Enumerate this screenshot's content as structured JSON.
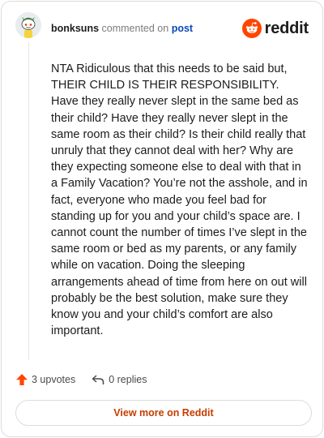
{
  "header": {
    "username": "bonksuns",
    "commented_text": "commented on",
    "post_link": "post",
    "logo_word": "reddit"
  },
  "comment": {
    "body": "NTA Ridiculous that this needs to be said but, THEIR CHILD IS THEIR RESPONSIBILITY. Have they really never slept in the same bed as their child? Have they really never slept in the same room as their child? Is their child really that unruly that they cannot deal with her? Why are they expecting someone else to deal with that in a Family Vacation? You’re not the asshole, and in fact, everyone who made you feel bad for standing up for you and your child’s space are. I cannot count the number of times I’ve slept in the same room or bed as my parents, or any family while on vacation. Doing the sleeping arrangements ahead of time from here on out will probably be the best solution, make sure they know you and your child’s comfort are also important."
  },
  "actions": {
    "upvotes_label": "3 upvotes",
    "replies_label": "0 replies"
  },
  "view_more_label": "View more on Reddit",
  "icons": {
    "avatar": "snoo-avatar-icon",
    "logo": "reddit-logo-icon",
    "upvote": "upvote-arrow-icon",
    "reply": "reply-arrow-icon"
  },
  "colors": {
    "reddit_orange": "#ff4500",
    "link_blue": "#0a49b8",
    "view_more_text": "#c43d00",
    "muted_text": "#7c7c7c"
  }
}
